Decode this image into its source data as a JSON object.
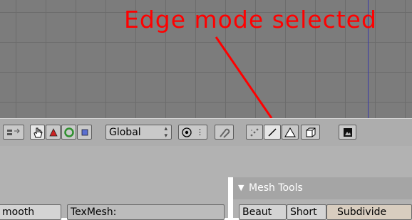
{
  "annotation": {
    "text": "Edge mode selected"
  },
  "header_toolbar": {
    "orientation_select": "Global",
    "select_mode_active": "edge"
  },
  "properties_panel": {
    "smooth_button": "mooth",
    "texmesh_field": "TexMesh:"
  },
  "mesh_tools": {
    "title": "Mesh Tools",
    "buttons": [
      "Beaut",
      "Short",
      "Subdivide"
    ]
  },
  "colors": {
    "annotation": "#ff0000",
    "viewport_bg": "#7c7c7c",
    "header_bg": "#adadad",
    "panel_bg": "#b2b2b2"
  },
  "icons": [
    "layer-icon",
    "hand-icon",
    "translate-icon",
    "rotate-icon",
    "scale-icon",
    "pivot-icon",
    "snap-icon",
    "vertex-select-icon",
    "edge-select-icon",
    "face-select-icon",
    "occlude-icon",
    "render-icon"
  ]
}
